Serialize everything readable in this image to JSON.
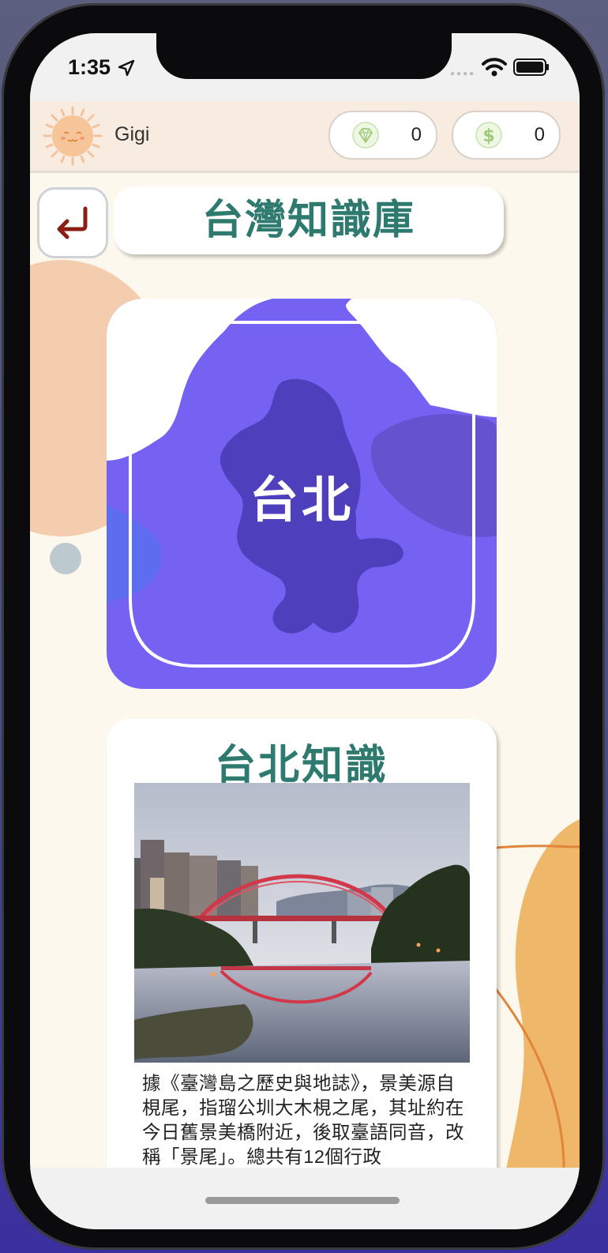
{
  "status_bar": {
    "time": "1:35"
  },
  "header": {
    "username": "Gigi",
    "gems": {
      "icon": "diamond-icon",
      "value": "0"
    },
    "coins": {
      "icon": "dollar-icon",
      "value": "0"
    }
  },
  "page": {
    "back_icon": "return-arrow-icon",
    "title": "台灣知識庫"
  },
  "region_card": {
    "label": "台北",
    "colors": {
      "background": "#7562f2",
      "region": "#4e3fbd",
      "outline": "#ffffff"
    }
  },
  "info_card": {
    "title": "台北知識",
    "photo": "city-bridge-at-dusk-photo",
    "text": "據《臺灣島之歷史與地誌》，景美源自梘尾，指瑠公圳大木梘之尾，其址約在今日舊景美橋附近，後取臺語同音，改稱「景尾」。總共有12個行政"
  },
  "theme": {
    "accent": "#2e7a6f",
    "back_arrow": "#8b1e14"
  }
}
